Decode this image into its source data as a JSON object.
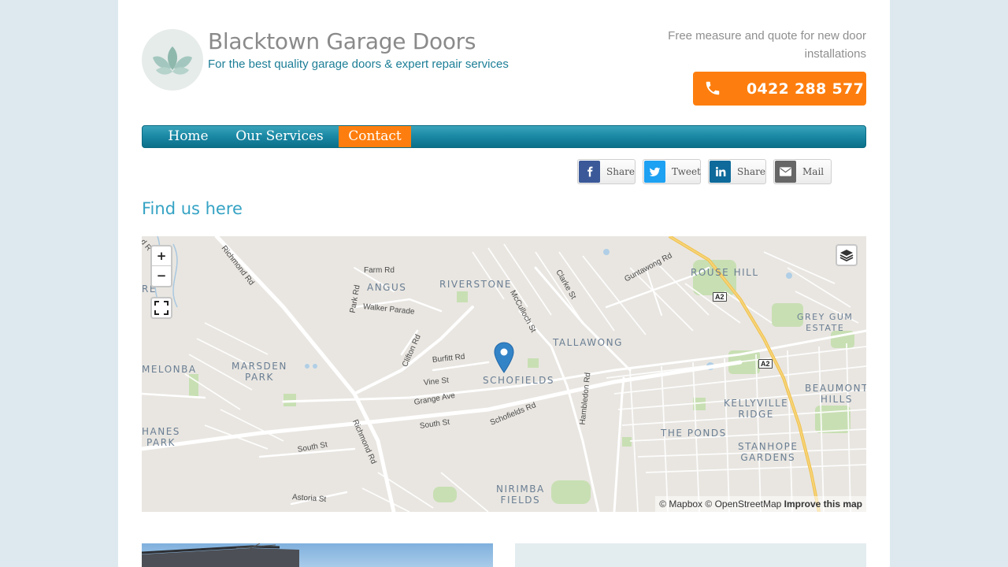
{
  "header": {
    "site_title": "Blacktown Garage Doors",
    "tagline": "For the best quality garage doors & expert repair services",
    "promo_text": "Free measure and quote for new door installations",
    "phone": "0422 288 577",
    "logo_icon": "lotus-icon",
    "phone_icon": "phone-icon"
  },
  "nav": {
    "items": [
      {
        "label": "Home",
        "active": false
      },
      {
        "label": "Our Services",
        "active": false
      },
      {
        "label": "Contact",
        "active": true
      }
    ]
  },
  "share": [
    {
      "label": "Share",
      "network": "facebook",
      "glyph": "f",
      "color": "#3b5998",
      "icon": "facebook-icon"
    },
    {
      "label": "Tweet",
      "network": "twitter",
      "glyph": "t",
      "color": "#1da1f2",
      "icon": "twitter-icon"
    },
    {
      "label": "Share",
      "network": "linkedin",
      "glyph": "in",
      "color": "#0e6a9a",
      "icon": "linkedin-icon"
    },
    {
      "label": "Mail",
      "network": "email",
      "glyph": "✉",
      "color": "#666666",
      "icon": "mail-icon"
    }
  ],
  "section_title": "Find us here",
  "map": {
    "zoom_in": "+",
    "zoom_out": "−",
    "attribution": {
      "mapbox": "© Mapbox",
      "osm": "© OpenStreetMap",
      "improve": "Improve this map"
    },
    "places": {
      "angus": "ANGUS",
      "riverstone": "RIVERSTONE",
      "rouse_hill": "ROUSE HILL",
      "grey_gum": "GREY GUM\nESTATE",
      "tallawong": "TALLAWONG",
      "schofields": "SCHOFIELDS",
      "marsden_park": "MARSDEN\nPARK",
      "melonba": "MELONBA",
      "kellyville_ridge": "KELLYVILLE\nRIDGE",
      "beaumont_hills": "BEAUMONT\nHILLS",
      "the_ponds": "THE PONDS",
      "stanhope_gardens": "STANHOPE\nGARDENS",
      "hanes_park": "HANES\nPARK",
      "nirimba_fields": "NIRIMBA\nFIELDS",
      "re": "RE"
    },
    "streets": {
      "richmond_rd_north": "Richmond Rd",
      "richmond_rd_south": "Richmond Rd",
      "farm_rd": "Farm Rd",
      "park_rd": "Park Rd",
      "walker_parade": "Walker Parade",
      "clifton_rd": "Clifton Rd",
      "burfitt_rd": "Burfitt Rd",
      "vine_st": "Vine St",
      "grange_ave": "Grange Ave",
      "south_st": "South St",
      "south_st_west": "South St",
      "astoria_st": "Astoria St",
      "schofields_rd": "Schofields Rd",
      "mcculloch_st": "McCulloch St",
      "clarke_st": "Clarke St",
      "guntawong_rd": "Guntawong Rd",
      "hambledon_rd": "Hambledon Rd",
      "rd_fragment": "d R"
    },
    "shields": {
      "a2_north": "A2",
      "a2_south": "A2"
    }
  }
}
